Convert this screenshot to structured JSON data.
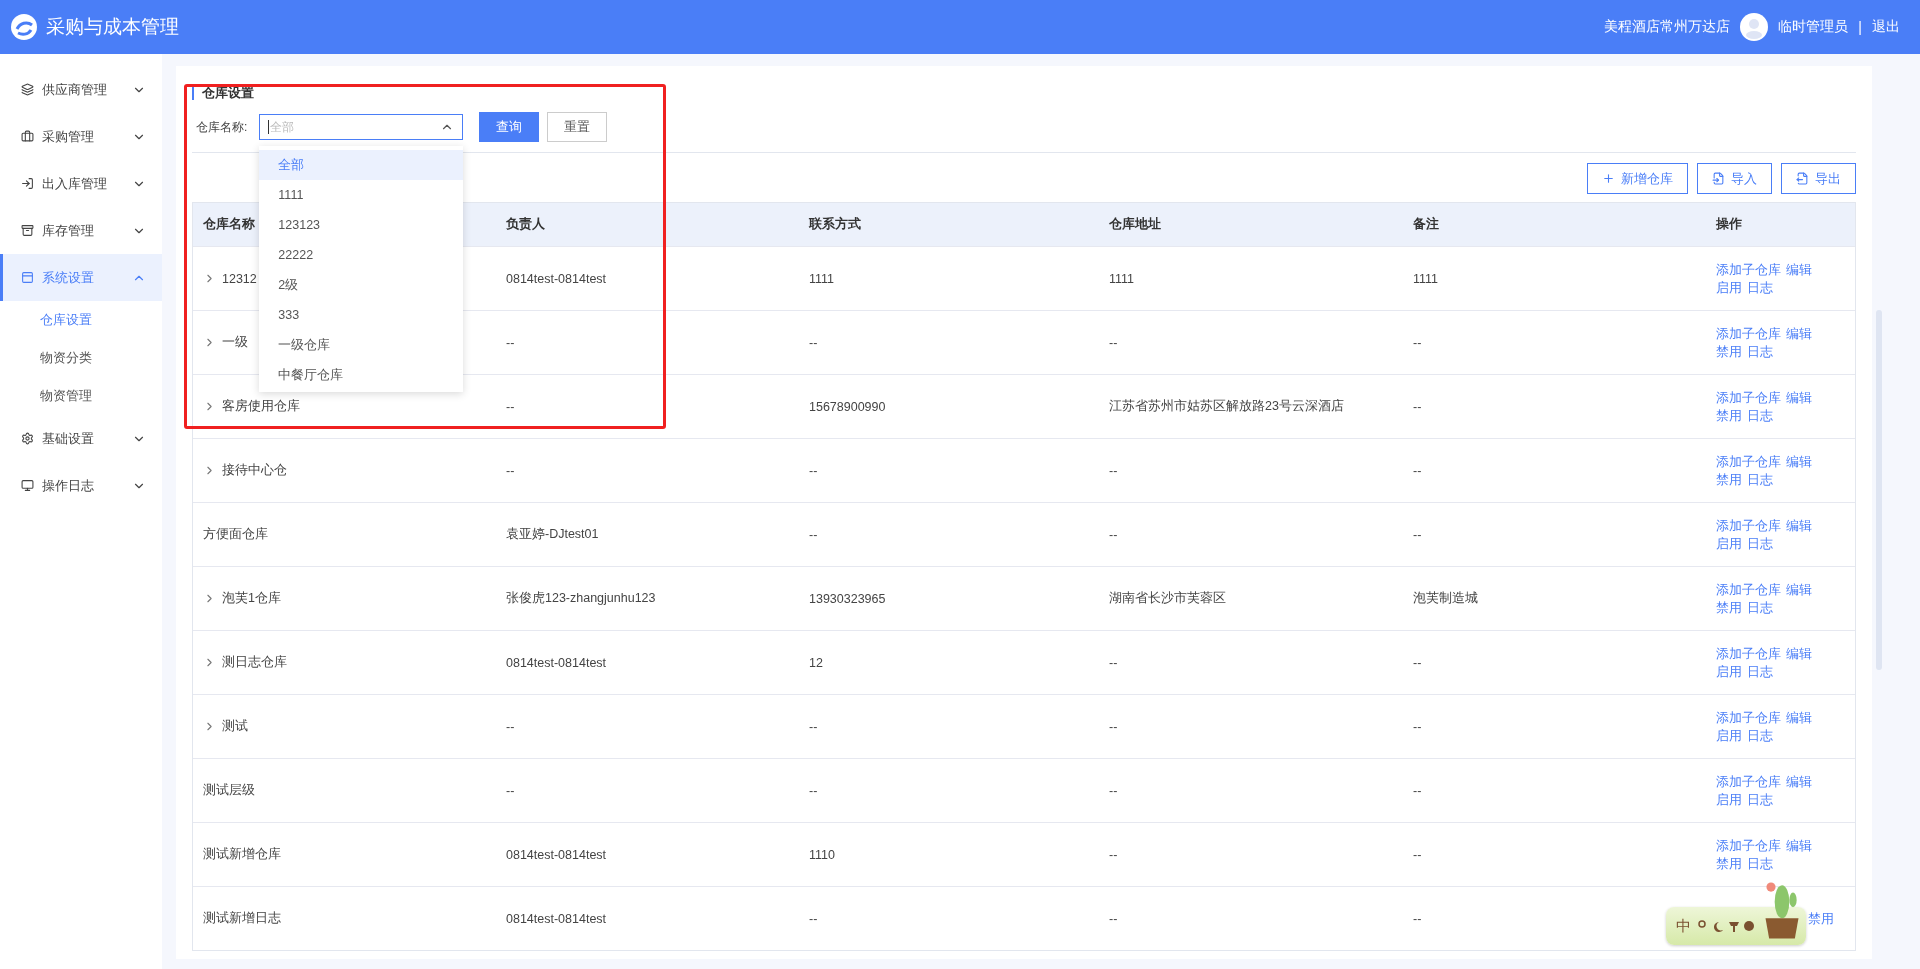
{
  "header": {
    "app_title": "采购与成本管理",
    "store": "美程酒店常州万达店",
    "user": "临时管理员",
    "separator": "|",
    "logout": "退出"
  },
  "sidebar": {
    "items": [
      {
        "label": "供应商管理",
        "expanded": false,
        "selected": false
      },
      {
        "label": "采购管理",
        "expanded": false,
        "selected": false
      },
      {
        "label": "出入库管理",
        "expanded": false,
        "selected": false
      },
      {
        "label": "库存管理",
        "expanded": false,
        "selected": false
      },
      {
        "label": "系统设置",
        "expanded": true,
        "selected": true,
        "children": [
          {
            "label": "仓库设置",
            "selected": true
          },
          {
            "label": "物资分类",
            "selected": false
          },
          {
            "label": "物资管理",
            "selected": false
          }
        ]
      },
      {
        "label": "基础设置",
        "expanded": false,
        "selected": false
      },
      {
        "label": "操作日志",
        "expanded": false,
        "selected": false
      }
    ]
  },
  "page_title": "仓库设置",
  "filter": {
    "label": "仓库名称:",
    "placeholder": "全部",
    "open": true,
    "options": [
      {
        "label": "全部",
        "selected": true
      },
      {
        "label": "1111",
        "selected": false
      },
      {
        "label": "123123",
        "selected": false
      },
      {
        "label": "22222",
        "selected": false
      },
      {
        "label": "2级",
        "selected": false
      },
      {
        "label": "333",
        "selected": false
      },
      {
        "label": "一级仓库",
        "selected": false
      },
      {
        "label": "中餐厅仓库",
        "selected": false
      }
    ],
    "query": "查询",
    "reset": "重置"
  },
  "actions": [
    {
      "label": "新增仓库",
      "kind": "add"
    },
    {
      "label": "导入",
      "kind": "import"
    },
    {
      "label": "导出",
      "kind": "export"
    }
  ],
  "table": {
    "columns": [
      "仓库名称",
      "负责人",
      "联系方式",
      "仓库地址",
      "备注",
      "操作"
    ],
    "rows": [
      {
        "expandable": true,
        "cells": [
          "12312",
          "0814test-0814test",
          "1111",
          "1111",
          "1111"
        ],
        "ops": [
          "添加子仓库",
          "编辑",
          "启用",
          "日志"
        ]
      },
      {
        "expandable": true,
        "cells": [
          "一级",
          "--",
          "--",
          "--",
          "--"
        ],
        "ops": [
          "添加子仓库",
          "编辑",
          "禁用",
          "日志"
        ]
      },
      {
        "expandable": true,
        "cells": [
          "客房使用仓库",
          "--",
          "15678900990",
          "江苏省苏州市姑苏区解放路23号云深酒店",
          "--"
        ],
        "ops": [
          "添加子仓库",
          "编辑",
          "禁用",
          "日志"
        ]
      },
      {
        "expandable": true,
        "cells": [
          "接待中心仓",
          "--",
          "--",
          "--",
          "--"
        ],
        "ops": [
          "添加子仓库",
          "编辑",
          "禁用",
          "日志"
        ]
      },
      {
        "expandable": false,
        "cells": [
          "方便面仓库",
          "袁亚婷-DJtest01",
          "--",
          "--",
          "--"
        ],
        "ops": [
          "添加子仓库",
          "编辑",
          "启用",
          "日志"
        ]
      },
      {
        "expandable": true,
        "cells": [
          "泡芙1仓库",
          "张俊虎123-zhangjunhu123",
          "13930323965",
          "湖南省长沙市芙蓉区",
          "泡芙制造城"
        ],
        "ops": [
          "添加子仓库",
          "编辑",
          "禁用",
          "日志"
        ]
      },
      {
        "expandable": true,
        "cells": [
          "测日志仓库",
          "0814test-0814test",
          "12",
          "--",
          "--"
        ],
        "ops": [
          "添加子仓库",
          "编辑",
          "启用",
          "日志"
        ]
      },
      {
        "expandable": true,
        "cells": [
          "测试",
          "--",
          "--",
          "--",
          "--"
        ],
        "ops": [
          "添加子仓库",
          "编辑",
          "启用",
          "日志"
        ]
      },
      {
        "expandable": false,
        "cells": [
          "测试层级",
          "--",
          "--",
          "--",
          "--"
        ],
        "ops": [
          "添加子仓库",
          "编辑",
          "启用",
          "日志"
        ]
      },
      {
        "expandable": false,
        "cells": [
          "测试新增仓库",
          "0814test-0814test",
          "1110",
          "--",
          "--"
        ],
        "ops": [
          "添加子仓库",
          "编辑",
          "禁用",
          "日志"
        ]
      },
      {
        "expandable": false,
        "covered": true,
        "cells": [
          "测试新增日志",
          "0814test-0814test",
          "--",
          "--",
          "--"
        ],
        "ops": [
          "禁用"
        ]
      }
    ]
  },
  "ime": {
    "label": "中"
  }
}
